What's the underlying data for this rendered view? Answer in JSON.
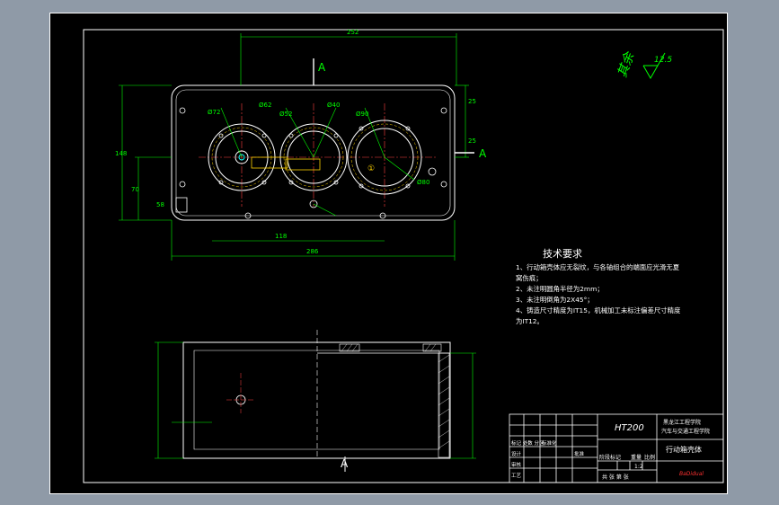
{
  "drawing": {
    "section_labels": {
      "top_a": "A",
      "right_a": "A",
      "bottom_a": "A"
    },
    "roughness": {
      "value": "12.5",
      "note": "其余"
    },
    "dimensions": {
      "top_overall": "252",
      "overall_width": "286",
      "left_height": "148",
      "left_mid": "70",
      "left_low": "58",
      "bottom_mid": "118",
      "right_small": "25",
      "right_mid": "25"
    },
    "hole_labels": [
      "Ø72",
      "Ø62",
      "Ø52",
      "Ø40",
      "Ø90",
      "Ø80"
    ],
    "datum": "①"
  },
  "tech_req": {
    "title": "技术要求",
    "lines": [
      "1、行动箱壳体应无裂纹，与各轴组合的端面应光滑无夏",
      "    窝伤痕；",
      "2、未注明圆角半径为2mm；",
      "3、未注明倒角为2X45°；",
      "4、铸造尺寸精度为IT15，机械加工未标注偏差尺寸精度",
      "为IT12。"
    ]
  },
  "title_block": {
    "material": "HT200",
    "school_line1": "黑龙江工程学院",
    "school_line2": "汽车与交通工程学院",
    "part_name": "行动箱壳体",
    "stage_label": "阶段标记",
    "weight_label": "重量",
    "scale_label": "比例",
    "scale": "1:2",
    "sheet_label": "共 张 第 张",
    "row1": "标记 处数 分区",
    "row2": "设计",
    "row3": "审核",
    "row4": "工艺",
    "std_label": "标准化",
    "approve_label": "批准",
    "brand": "BaDidual"
  }
}
